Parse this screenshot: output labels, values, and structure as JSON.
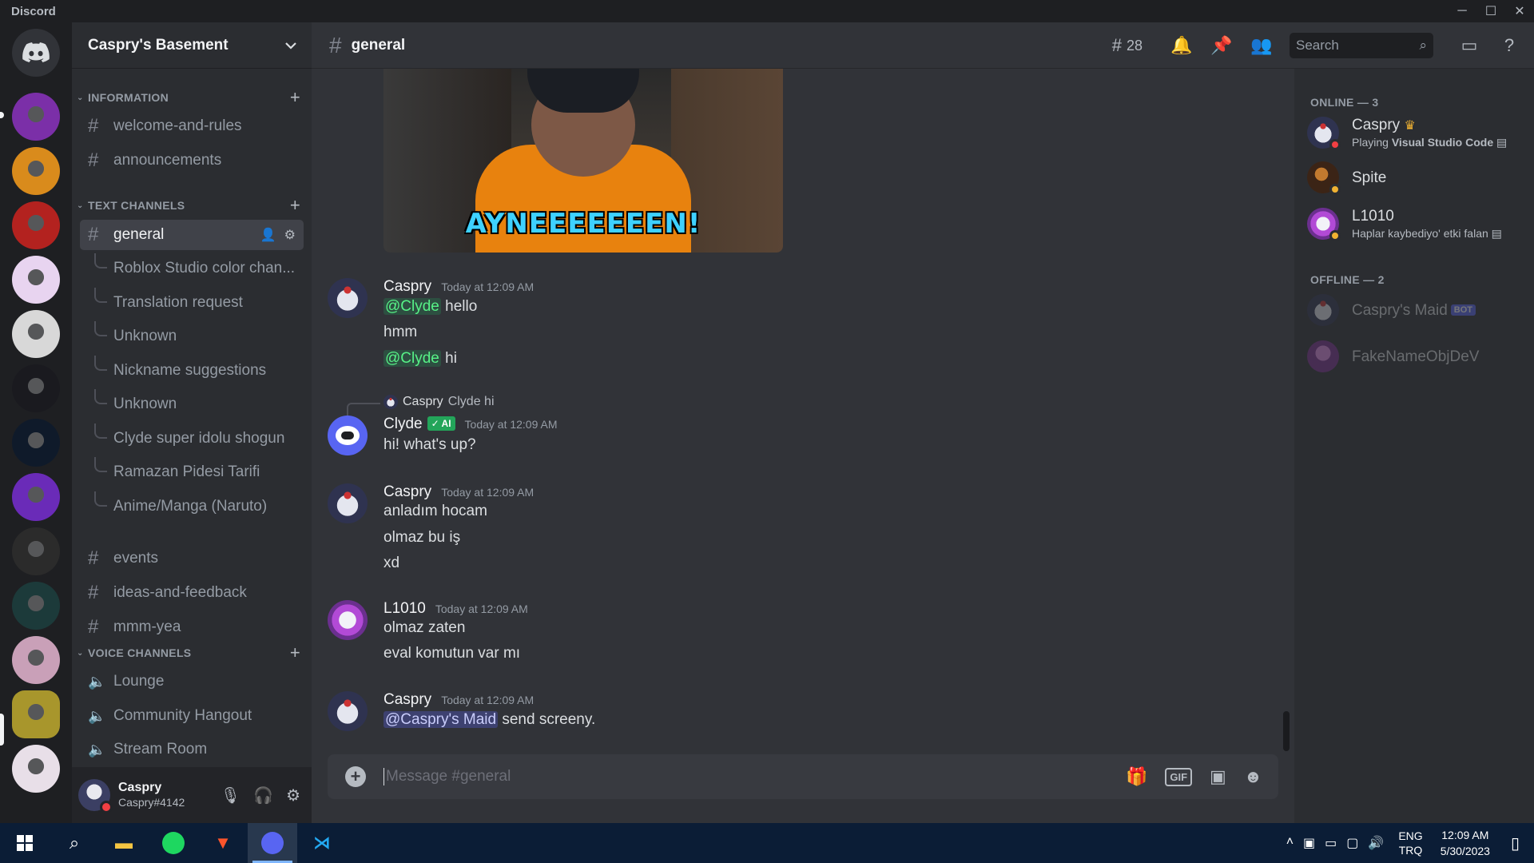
{
  "window": {
    "brand": "Discord",
    "controls": [
      "─",
      "☐",
      "✕"
    ]
  },
  "server": {
    "name": "Caspry's Basement",
    "chevron": "⌄"
  },
  "servers": {
    "colors": [
      "#7b2fa8",
      "#d98b1c",
      "#b3221f",
      "#e8d4f0",
      "#d8d8d8",
      "#1a1a1f",
      "#0f1a2a",
      "#6a2bb8",
      "#2b2b2b",
      "#1c3a3a",
      "#c9a0b8",
      "#a8962c",
      "#e8dfe8"
    ]
  },
  "sidebar": {
    "cat_information": "INFORMATION",
    "cat_text": "TEXT CHANNELS",
    "cat_voice": "VOICE CHANNELS",
    "info_channels": [
      "welcome-and-rules",
      "announcements"
    ],
    "active_channel": "general",
    "threads": [
      "Roblox Studio color chan...",
      "Translation request",
      "Unknown",
      "Nickname suggestions",
      "Unknown",
      "Clyde super idolu shogun",
      "Ramazan Pidesi Tarifi",
      "Anime/Manga (Naruto)"
    ],
    "text_channels": [
      "events",
      "ideas-and-feedback",
      "mmm-yea"
    ],
    "voice_channels": [
      "Lounge",
      "Community Hangout",
      "Stream Room"
    ]
  },
  "user": {
    "name": "Caspry",
    "tag": "Caspry#4142"
  },
  "header": {
    "channel": "general",
    "threads_count": "28",
    "search_placeholder": "Search"
  },
  "gif": {
    "caption": "AYNEEEEEEEN!"
  },
  "messages": [
    {
      "author": "Caspry",
      "time": "Today at 12:09 AM",
      "lines": [
        [
          "@Clyde",
          " hello"
        ],
        [
          "",
          "hmm"
        ],
        [
          "@Clyde",
          " hi"
        ]
      ]
    },
    {
      "reply": {
        "name": "Caspry",
        "text": "Clyde hi"
      },
      "author": "Clyde",
      "badge": "✓ AI",
      "time": "Today at 12:09 AM",
      "lines": [
        [
          "",
          "hi! what's up?"
        ]
      ]
    },
    {
      "author": "Caspry",
      "time": "Today at 12:09 AM",
      "lines": [
        [
          "",
          "anladım hocam"
        ],
        [
          "",
          "olmaz bu iş"
        ],
        [
          "",
          "xd"
        ]
      ]
    },
    {
      "author": "L1010",
      "time": "Today at 12:09 AM",
      "lines": [
        [
          "",
          "olmaz zaten"
        ],
        [
          "",
          "eval komutun var mı"
        ]
      ]
    },
    {
      "author": "Caspry",
      "time": "Today at 12:09 AM",
      "lines": [
        [
          "@Caspry's Maid",
          " send screeny."
        ]
      ]
    }
  ],
  "composer": {
    "placeholder": "Message #general",
    "gif_label": "GIF"
  },
  "members": {
    "online_header": "ONLINE — 3",
    "offline_header": "OFFLINE — 2",
    "online": [
      {
        "name": "Caspry",
        "crown": "♛",
        "activity_prefix": "Playing ",
        "activity": "Visual Studio Code"
      },
      {
        "name": "Spite",
        "activity_prefix": "",
        "activity": ""
      },
      {
        "name": "L1010",
        "activity_prefix": "",
        "activity": "Haplar kaybediyo' etki falan"
      }
    ],
    "offline": [
      {
        "name": "Caspry's Maid",
        "badge": "BOT"
      },
      {
        "name": "FakeNameObjDeV"
      }
    ]
  },
  "taskbar": {
    "lang": "ENG",
    "layout": "TRQ",
    "time": "12:09 AM",
    "date": "5/30/2023"
  }
}
